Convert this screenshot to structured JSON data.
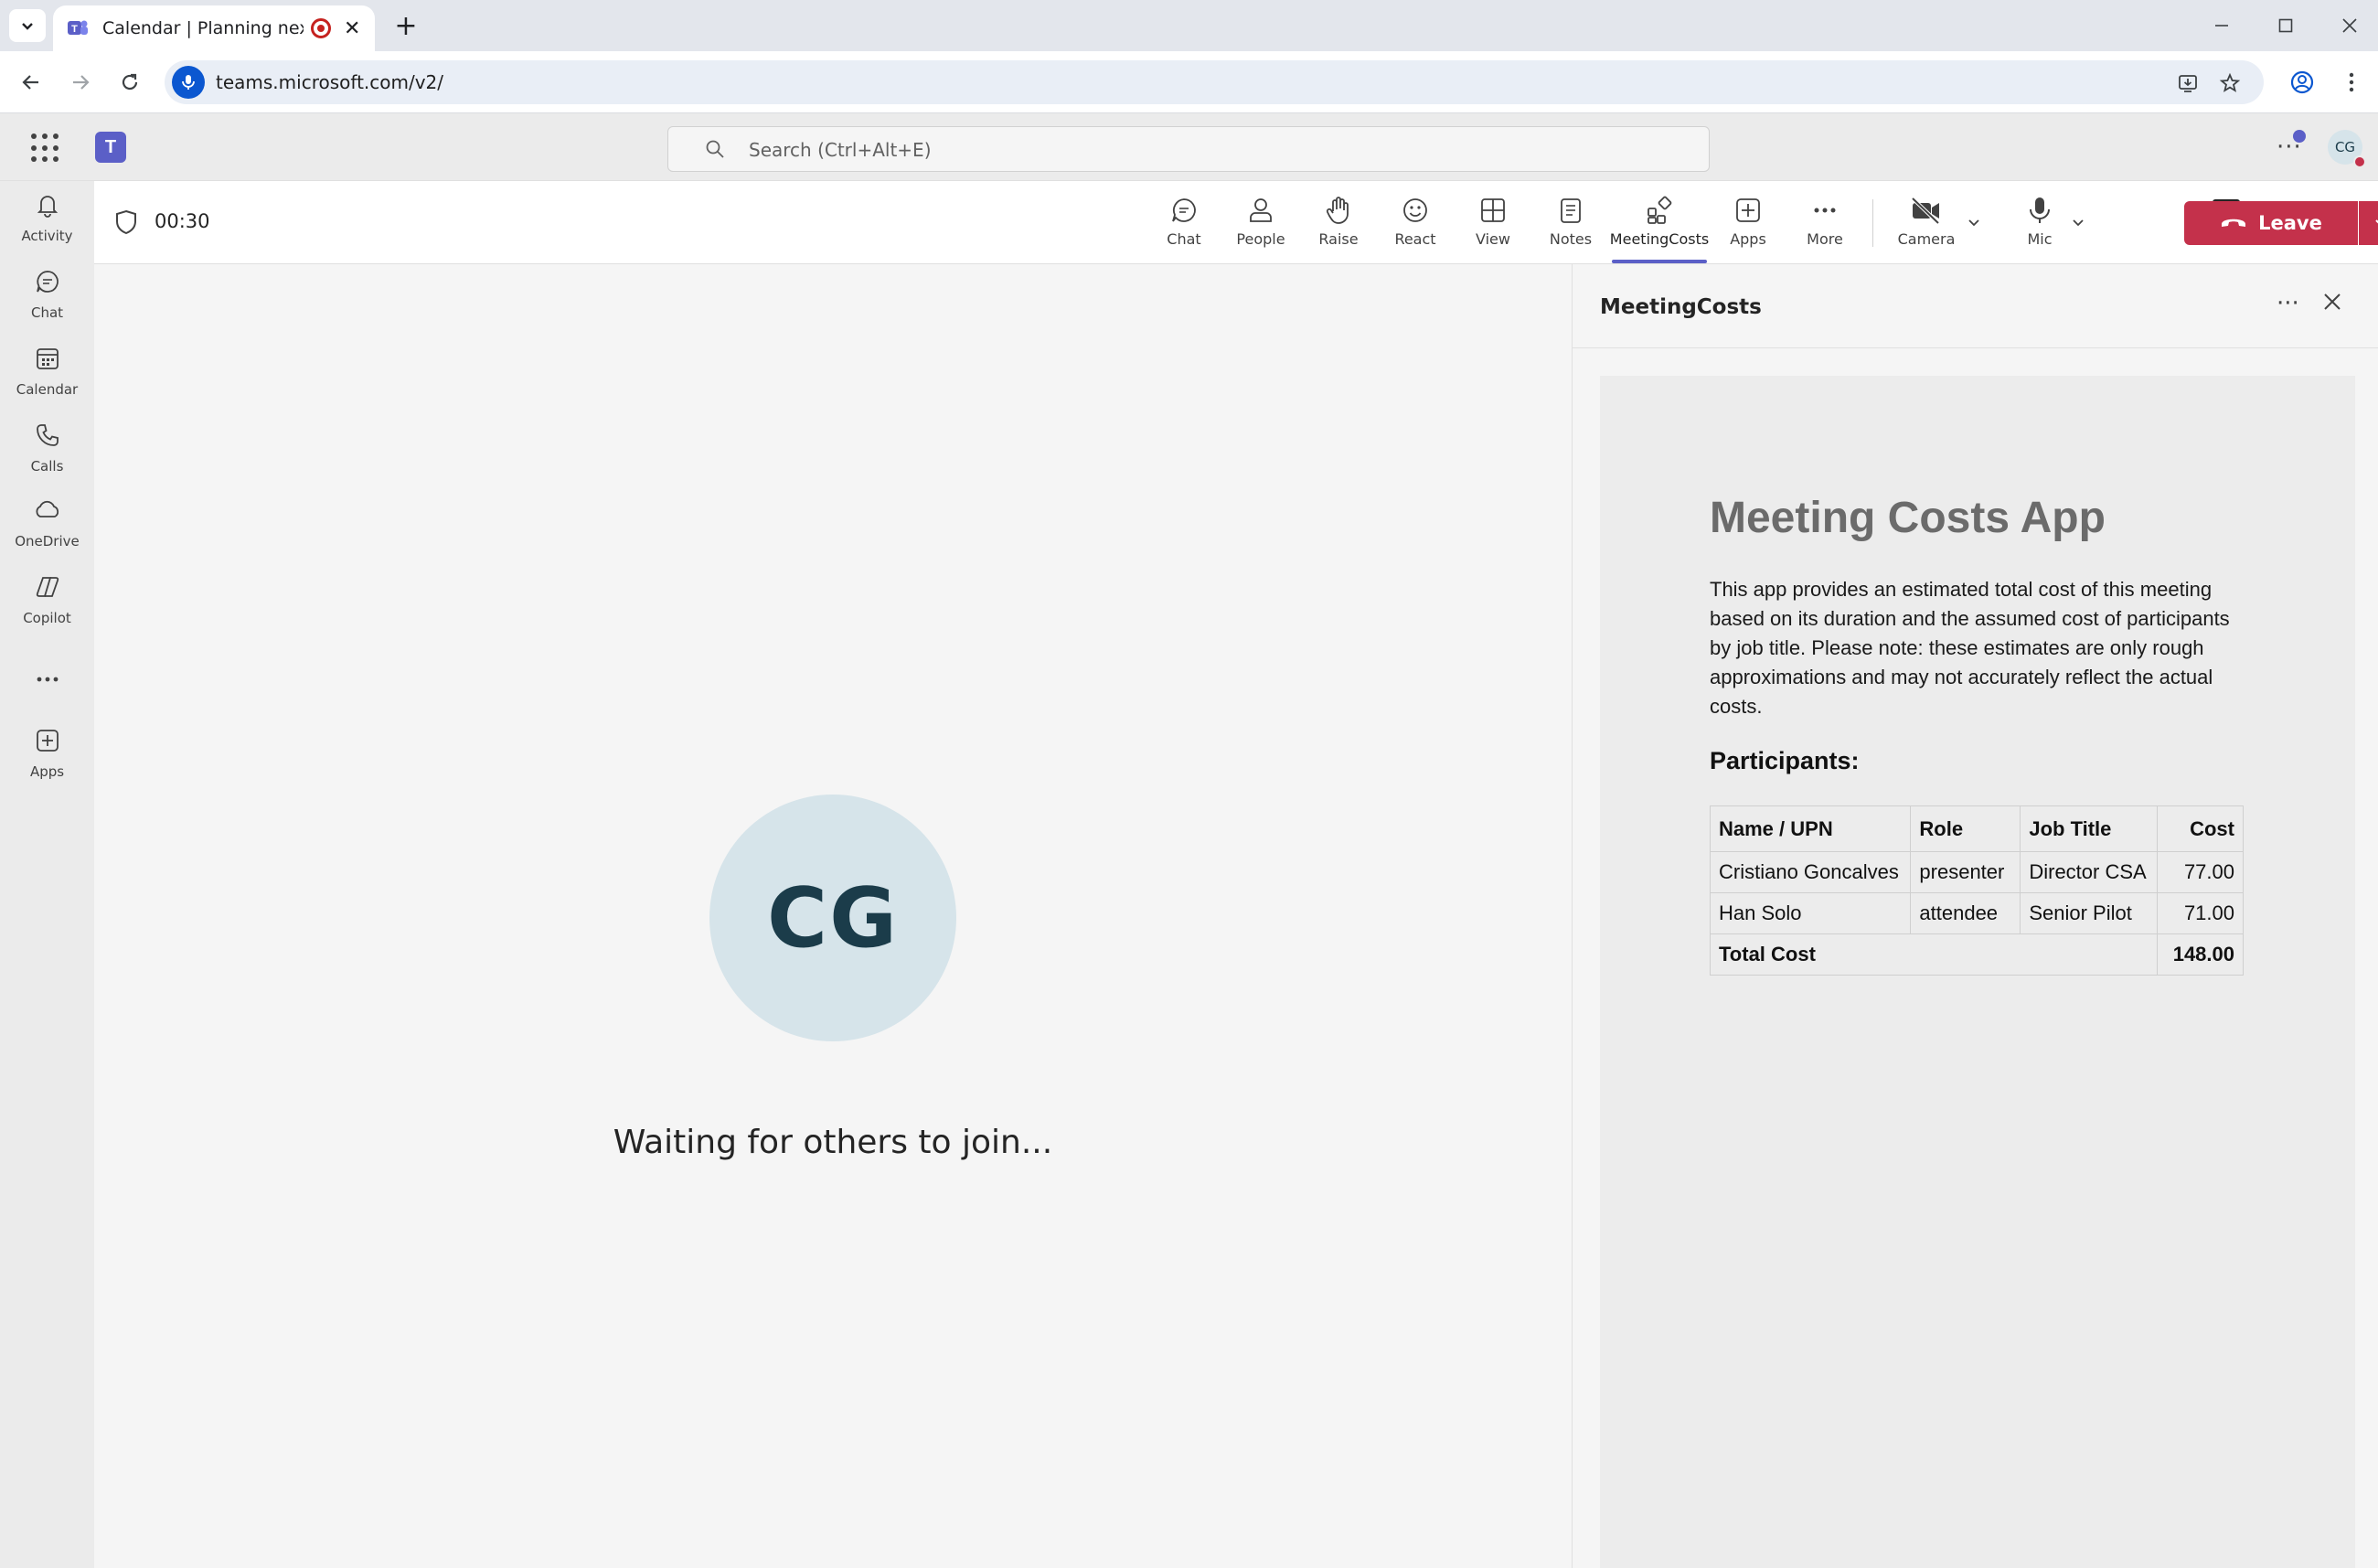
{
  "browser": {
    "tab_title": "Calendar | Planning next flig",
    "url": "teams.microsoft.com/v2/"
  },
  "teams": {
    "search_placeholder": "Search (Ctrl+Alt+E)",
    "user_initials": "CG",
    "rail": [
      {
        "label": "Activity",
        "icon": "bell-icon"
      },
      {
        "label": "Chat",
        "icon": "chat-icon"
      },
      {
        "label": "Calendar",
        "icon": "calendar-icon"
      },
      {
        "label": "Calls",
        "icon": "phone-icon"
      },
      {
        "label": "OneDrive",
        "icon": "cloud-icon"
      },
      {
        "label": "Copilot",
        "icon": "copilot-icon"
      },
      {
        "label": "",
        "icon": "more-icon"
      },
      {
        "label": "Apps",
        "icon": "add-apps-icon"
      }
    ]
  },
  "meeting": {
    "timer": "00:30",
    "toolbar": {
      "chat": "Chat",
      "people": "People",
      "raise": "Raise",
      "react": "React",
      "view": "View",
      "notes": "Notes",
      "meetingcosts": "MeetingCosts",
      "apps": "Apps",
      "more": "More",
      "camera": "Camera",
      "mic": "Mic",
      "share": "Share",
      "leave": "Leave"
    },
    "avatar_initials": "CG",
    "waiting_text": "Waiting for others to join..."
  },
  "panel": {
    "title": "MeetingCosts",
    "app_title": "Meeting Costs App",
    "description": "This app provides an estimated total cost of this meeting based on its duration and the assumed cost of participants by job title. Please note: these estimates are only rough approximations and may not accurately reflect the actual costs.",
    "participants_heading": "Participants:",
    "table": {
      "headers": {
        "name": "Name / UPN",
        "role": "Role",
        "job": "Job Title",
        "cost": "Cost"
      },
      "rows": [
        {
          "name": "Cristiano Goncalves",
          "role": "presenter",
          "job": "Director CSA",
          "cost": "77.00"
        },
        {
          "name": "Han Solo",
          "role": "attendee",
          "job": "Senior Pilot",
          "cost": "71.00"
        }
      ],
      "total_label": "Total Cost",
      "total_value": "148.00"
    }
  },
  "colors": {
    "accent": "#5b5fc7",
    "leave": "#c4314b",
    "avatar_bg": "#d6e4ea"
  }
}
